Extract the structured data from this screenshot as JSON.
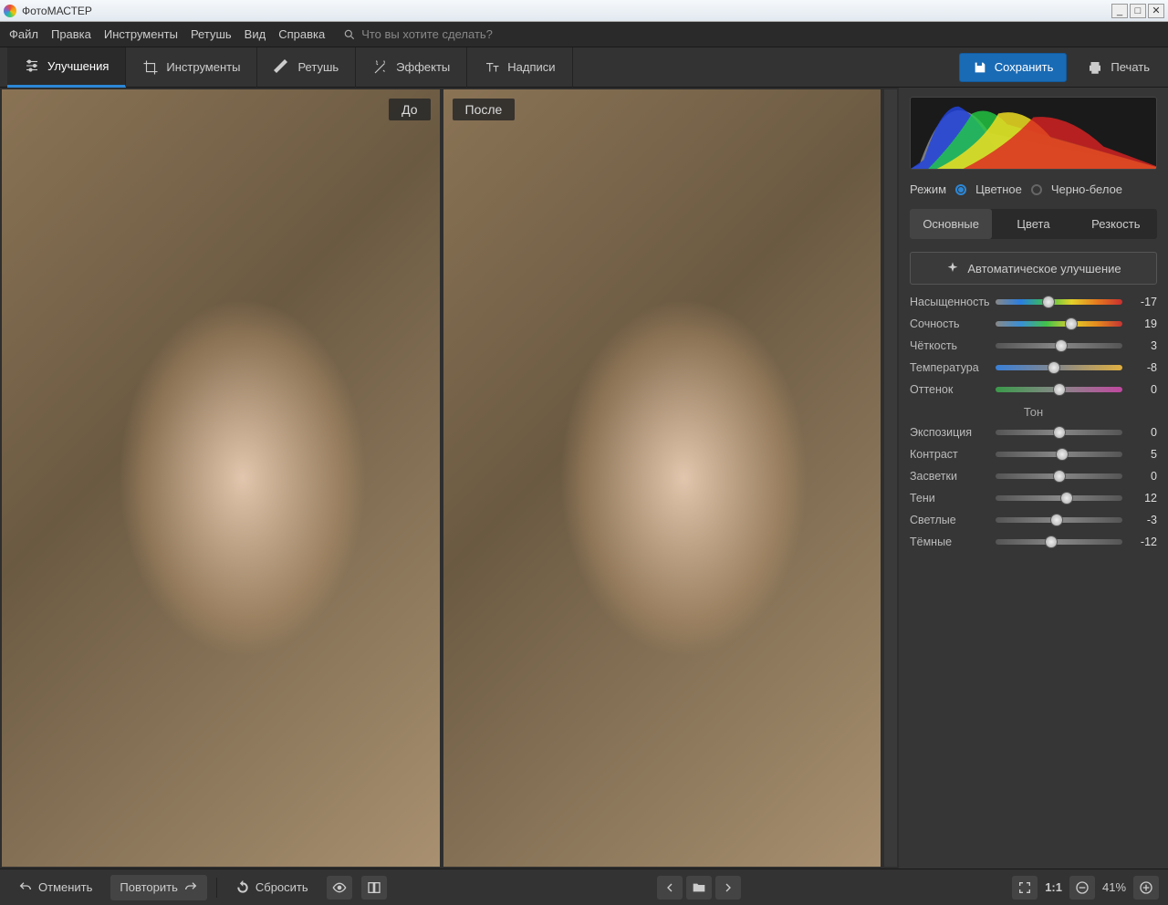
{
  "app": {
    "title": "ФотоМАСТЕР"
  },
  "menu": {
    "file": "Файл",
    "edit": "Правка",
    "tools": "Инструменты",
    "retouch": "Ретушь",
    "view": "Вид",
    "help": "Справка",
    "search_placeholder": "Что вы хотите сделать?"
  },
  "tabs": {
    "enhance": "Улучшения",
    "tools": "Инструменты",
    "retouch": "Ретушь",
    "effects": "Эффекты",
    "captions": "Надписи"
  },
  "actions": {
    "save": "Сохранить",
    "print": "Печать"
  },
  "canvas": {
    "before": "До",
    "after": "После"
  },
  "panel": {
    "mode_label": "Режим",
    "mode_color": "Цветное",
    "mode_bw": "Черно-белое",
    "subtabs": {
      "basic": "Основные",
      "colors": "Цвета",
      "sharpness": "Резкость"
    },
    "auto": "Автоматическое улучшение",
    "tone_header": "Тон",
    "sliders": [
      {
        "label": "Насыщенность",
        "value": -17,
        "min": -100,
        "max": 100,
        "gradient": "linear-gradient(90deg,#888,#2a7ee0,#3cc44a,#e4d22a,#e67a1f,#c92f2f)"
      },
      {
        "label": "Сочность",
        "value": 19,
        "min": -100,
        "max": 100,
        "gradient": "linear-gradient(90deg,#888,#3a8fd6,#42c24a,#e2cf2a,#e48a1f,#c63333)"
      },
      {
        "label": "Чёткость",
        "value": 3,
        "min": -100,
        "max": 100,
        "gradient": "linear-gradient(90deg,#555,#888,#555)"
      },
      {
        "label": "Температура",
        "value": -8,
        "min": -100,
        "max": 100,
        "gradient": "linear-gradient(90deg,#3a7fd6,#888,#e0b040)"
      },
      {
        "label": "Оттенок",
        "value": 0,
        "min": -100,
        "max": 100,
        "gradient": "linear-gradient(90deg,#3a9a4a,#888,#c048a0)"
      }
    ],
    "tone_sliders": [
      {
        "label": "Экспозиция",
        "value": 0,
        "min": -100,
        "max": 100
      },
      {
        "label": "Контраст",
        "value": 5,
        "min": -100,
        "max": 100
      },
      {
        "label": "Засветки",
        "value": 0,
        "min": -100,
        "max": 100
      },
      {
        "label": "Тени",
        "value": 12,
        "min": -100,
        "max": 100
      },
      {
        "label": "Светлые",
        "value": -3,
        "min": -100,
        "max": 100
      },
      {
        "label": "Тёмные",
        "value": -12,
        "min": -100,
        "max": 100
      }
    ]
  },
  "bottom": {
    "undo": "Отменить",
    "redo": "Повторить",
    "reset": "Сбросить",
    "zoom": "41%",
    "ratio": "1:1"
  }
}
